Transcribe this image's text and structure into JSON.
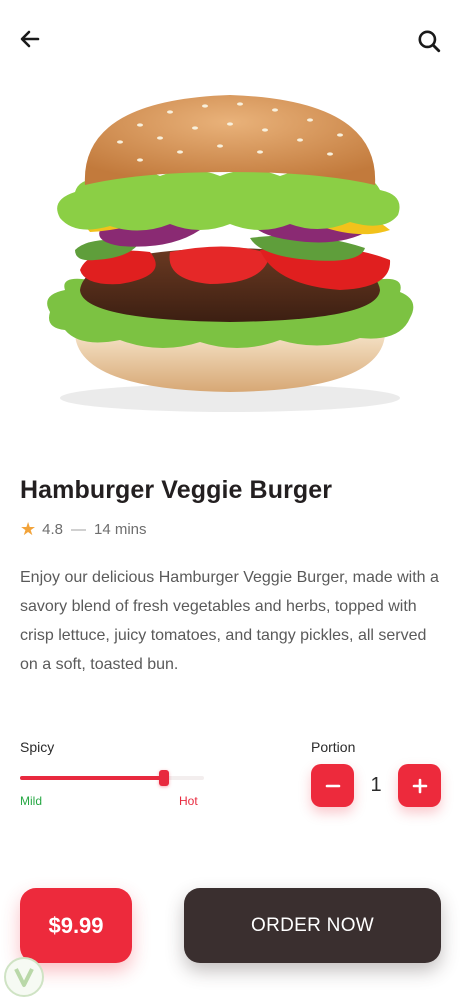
{
  "header": {
    "back_icon": "arrow-left-icon",
    "search_icon": "search-icon"
  },
  "product": {
    "name": "Hamburger Veggie Burger",
    "rating": "4.8",
    "separator": "—",
    "time": "14 mins",
    "description": "Enjoy our delicious Hamburger Veggie Burger, made with a savory blend of fresh vegetables and herbs, topped with crisp lettuce, juicy tomatoes, and tangy pickles, all served on a soft, toasted bun."
  },
  "spicy": {
    "label": "Spicy",
    "min_label": "Mild",
    "max_label": "Hot",
    "level": 0.78
  },
  "portion": {
    "label": "Portion",
    "quantity": "1",
    "minus_icon": "minus-icon",
    "plus_icon": "plus-icon"
  },
  "footer": {
    "price": "$9.99",
    "order_label": "ORDER NOW"
  },
  "colors": {
    "accent": "#ed2a3c",
    "dark": "#3a2f2f",
    "mild": "#27a844",
    "star": "#f2a33a"
  }
}
